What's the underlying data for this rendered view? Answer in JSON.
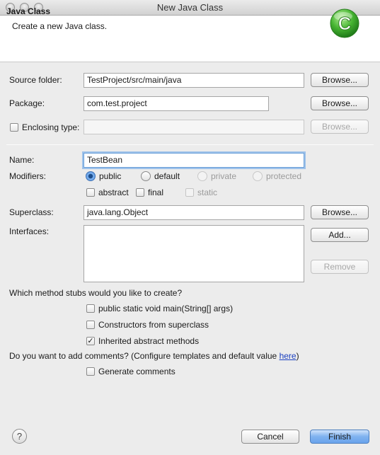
{
  "window": {
    "title": "New Java Class"
  },
  "header": {
    "title": "Java Class",
    "message": "Create a new Java class.",
    "icon_letter": "C"
  },
  "source_folder": {
    "label": "Source folder:",
    "value": "TestProject/src/main/java",
    "browse": "Browse..."
  },
  "package": {
    "label": "Package:",
    "value": "com.test.project",
    "browse": "Browse..."
  },
  "enclosing_type": {
    "label": "Enclosing type:",
    "value": "",
    "browse": "Browse...",
    "checked": false
  },
  "name": {
    "label": "Name:",
    "value": "TestBean"
  },
  "modifiers": {
    "label": "Modifiers:",
    "access": [
      {
        "label": "public",
        "selected": true,
        "enabled": true
      },
      {
        "label": "default",
        "selected": false,
        "enabled": true
      },
      {
        "label": "private",
        "selected": false,
        "enabled": false
      },
      {
        "label": "protected",
        "selected": false,
        "enabled": false
      }
    ],
    "other": [
      {
        "label": "abstract",
        "checked": false,
        "enabled": true
      },
      {
        "label": "final",
        "checked": false,
        "enabled": true
      },
      {
        "label": "static",
        "checked": false,
        "enabled": false
      }
    ]
  },
  "superclass": {
    "label": "Superclass:",
    "value": "java.lang.Object",
    "browse": "Browse..."
  },
  "interfaces": {
    "label": "Interfaces:",
    "add": "Add...",
    "remove": "Remove"
  },
  "stubs": {
    "question": "Which method stubs would you like to create?",
    "options": [
      {
        "label": "public static void main(String[] args)",
        "checked": false
      },
      {
        "label": "Constructors from superclass",
        "checked": false
      },
      {
        "label": "Inherited abstract methods",
        "checked": true
      }
    ]
  },
  "comments": {
    "question": "Do you want to add comments? (Configure templates and default value ",
    "link": "here",
    "suffix": ")",
    "option": {
      "label": "Generate comments",
      "checked": false
    }
  },
  "footer": {
    "help": "?",
    "cancel": "Cancel",
    "finish": "Finish"
  },
  "colors": {
    "accent": "#6aa4ec",
    "icon_green": "#3aa82e",
    "link": "#1b3fbf"
  }
}
